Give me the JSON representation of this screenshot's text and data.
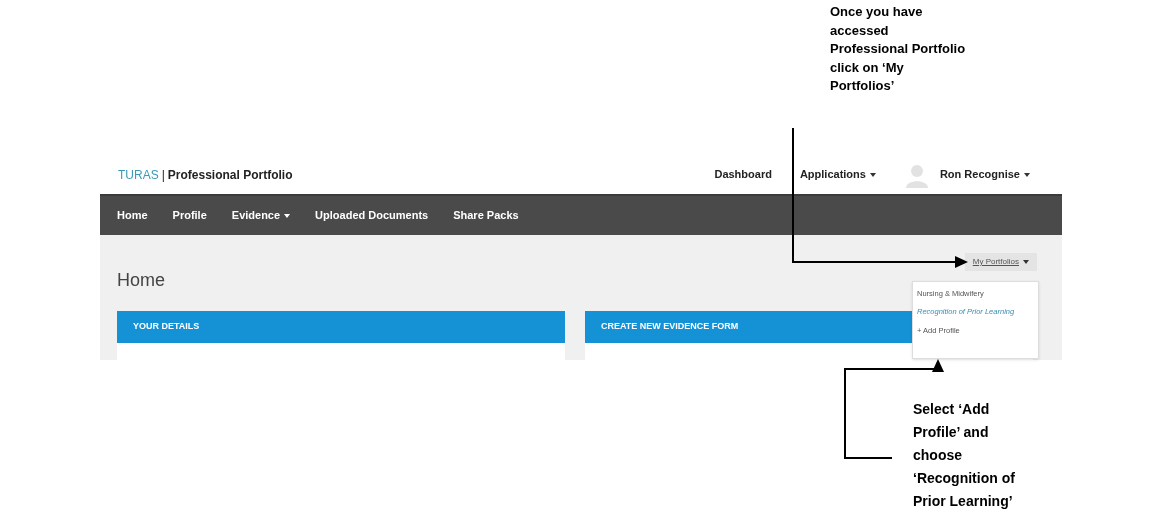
{
  "annotations": [
    {
      "text": "Once you have accessed Professional Portfolio click on ‘My Portfolios’"
    },
    {
      "text": "Select ‘Add Profile’ and choose ‘Recognition of Prior Learning’"
    }
  ],
  "header": {
    "brand": "TURAS",
    "separator": "|",
    "product": "Professional Portfolio",
    "links": [
      {
        "label": "Dashboard",
        "dropdown": false
      },
      {
        "label": "Applications",
        "dropdown": true
      }
    ],
    "user": {
      "name": "Ron Recognise",
      "dropdown": true
    }
  },
  "nav": [
    {
      "label": "Home",
      "dropdown": false
    },
    {
      "label": "Profile",
      "dropdown": false
    },
    {
      "label": "Evidence",
      "dropdown": true
    },
    {
      "label": "Uploaded Documents",
      "dropdown": false
    },
    {
      "label": "Share Packs",
      "dropdown": false
    }
  ],
  "page": {
    "title": "Home",
    "portfolio_menu": {
      "label": "My Portfolios",
      "items": [
        {
          "label": "Nursing & Midwifery",
          "kind": "item"
        },
        {
          "label": "Recognition of Prior Learning",
          "kind": "highlight"
        },
        {
          "label": "+ Add Profile",
          "kind": "item"
        }
      ]
    },
    "panels": [
      {
        "title": "YOUR DETAILS"
      },
      {
        "title": "CREATE NEW EVIDENCE FORM"
      }
    ]
  }
}
